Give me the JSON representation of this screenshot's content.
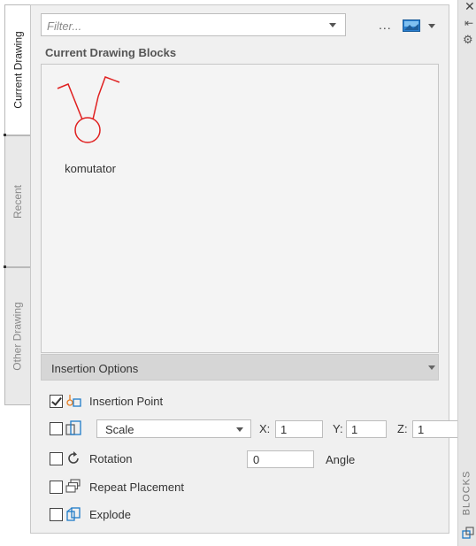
{
  "tabs": [
    {
      "label": "Current Drawing",
      "active": true
    },
    {
      "label": "Recent",
      "active": false
    },
    {
      "label": "Other Drawing",
      "active": false
    }
  ],
  "filter": {
    "placeholder": "Filter...",
    "value": ""
  },
  "toolbar": {
    "more_label": "...",
    "view_icon": "thumbnail-view-icon"
  },
  "section_title": "Current Drawing Blocks",
  "blocks": [
    {
      "name": "komutator",
      "icon": "switch-symbol-icon",
      "color": "#e02020"
    }
  ],
  "insertion": {
    "title": "Insertion Options",
    "insertion_point": {
      "label": "Insertion Point",
      "checked": true
    },
    "scale": {
      "checked": false,
      "mode": "Scale",
      "x_label": "X:",
      "x": "1",
      "y_label": "Y:",
      "y": "1",
      "z_label": "Z:",
      "z": "1"
    },
    "rotation": {
      "label": "Rotation",
      "checked": false,
      "value": "0",
      "angle_label": "Angle"
    },
    "repeat_placement": {
      "label": "Repeat Placement",
      "checked": false
    },
    "explode": {
      "label": "Explode",
      "checked": false
    }
  },
  "palette": {
    "title": "BLOCKS",
    "icons": [
      "close-icon",
      "auto-hide-icon",
      "properties-icon",
      "blocks-palette-icon"
    ]
  },
  "colors": {
    "accent": "#1e7bc8",
    "block_symbol": "#e02020",
    "header_bg": "#d6d6d6"
  }
}
